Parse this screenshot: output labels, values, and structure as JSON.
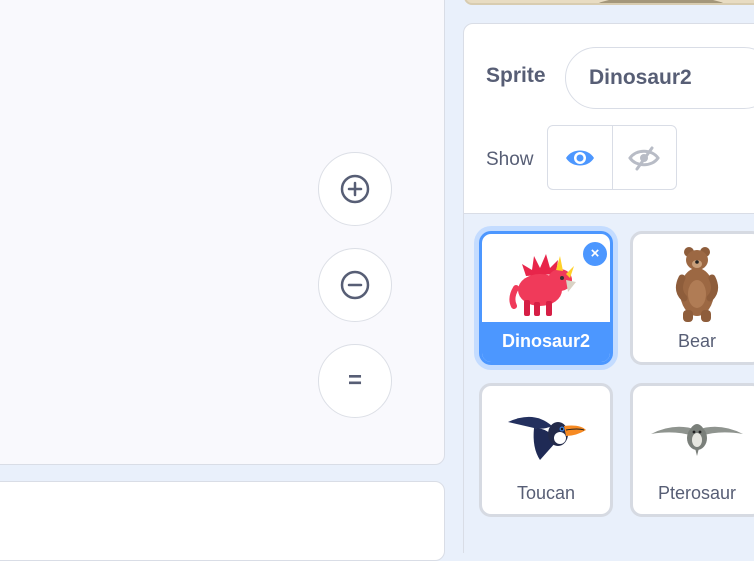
{
  "zoom_controls": {
    "zoom_in_icon": "zoom-in-icon",
    "zoom_out_icon": "zoom-out-icon",
    "zoom_reset_glyph": "="
  },
  "sprite_info": {
    "sprite_label": "Sprite",
    "sprite_name": "Dinosaur2",
    "show_label": "Show",
    "show_visible_icon": "eye-icon",
    "show_hidden_icon": "eye-slash-icon",
    "selected_visibility": "visible"
  },
  "sprites": [
    {
      "name": "Dinosaur2",
      "selected": true,
      "icon": "dinosaur-icon"
    },
    {
      "name": "Bear",
      "selected": false,
      "icon": "bear-icon"
    },
    {
      "name": "Toucan",
      "selected": false,
      "icon": "toucan-icon"
    },
    {
      "name": "Pterosaur",
      "selected": false,
      "icon": "pterosaur-icon"
    }
  ],
  "colors": {
    "accent": "#4c97ff",
    "text": "#575e75",
    "panel_bg": "#e9f0fb"
  }
}
